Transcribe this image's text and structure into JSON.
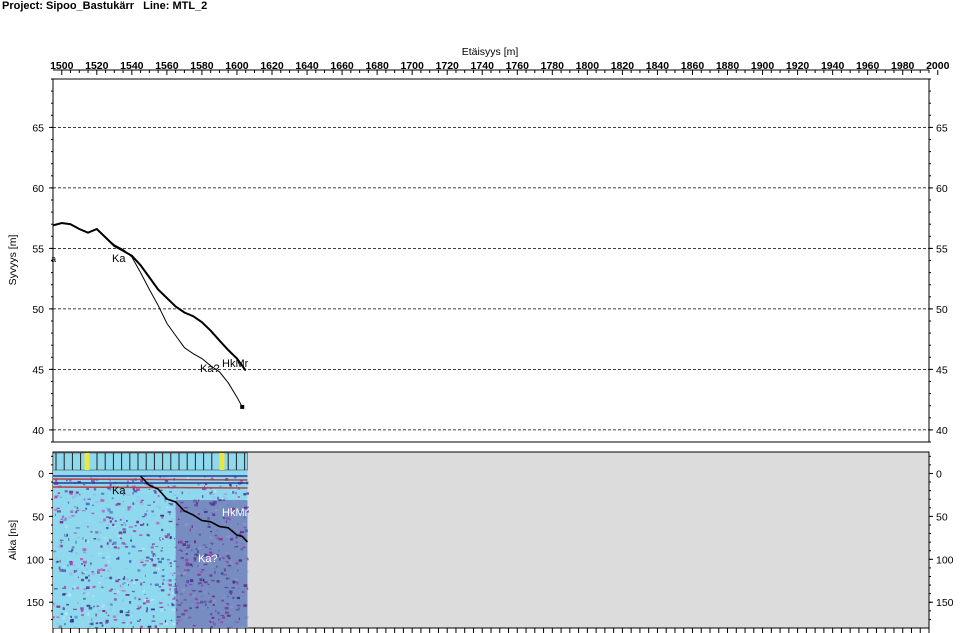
{
  "header": {
    "project_label": "Project: Sipoo_Bastukärr",
    "line_label": "Line: MTL_2"
  },
  "chart_data": [
    {
      "type": "line",
      "xlabel": "Etäisyys [m]",
      "ylabel": "Syvyys [m]",
      "xlim": [
        1495,
        1995
      ],
      "ylim": [
        39,
        69
      ],
      "x_ticks": [
        "1500",
        "1520",
        "1540",
        "1560",
        "1580",
        "1600",
        "1620",
        "1640",
        "1660",
        "1680",
        "1700",
        "1720",
        "1740",
        "1760",
        "1780",
        "1800",
        "1820",
        "1840",
        "1860",
        "1880",
        "1900",
        "1920",
        "1940",
        "1960",
        "1980",
        "2000"
      ],
      "y_ticks": [
        40,
        45,
        50,
        55,
        60,
        65
      ],
      "y_tick_labels": [
        "40",
        "45",
        "50",
        "55",
        "60",
        "65"
      ],
      "grid": "horizontal dashed",
      "series": [
        {
          "name": "HkMr",
          "x": [
            1495,
            1500,
            1505,
            1510,
            1515,
            1520,
            1525,
            1530,
            1535,
            1540,
            1545,
            1550,
            1555,
            1560,
            1565,
            1570,
            1575,
            1580,
            1585,
            1590,
            1595,
            1600,
            1605
          ],
          "y": [
            56.9,
            57.1,
            57.0,
            56.6,
            56.3,
            56.6,
            55.9,
            55.2,
            54.8,
            54.4,
            53.6,
            52.6,
            51.6,
            50.9,
            50.2,
            49.7,
            49.4,
            48.9,
            48.2,
            47.4,
            46.6,
            45.9,
            44.9
          ]
        },
        {
          "name": "Ka?",
          "x": [
            1495,
            1500,
            1505,
            1510,
            1515,
            1520,
            1525,
            1530,
            1535,
            1540,
            1545,
            1550,
            1555,
            1560,
            1565,
            1570,
            1575,
            1580,
            1585,
            1590,
            1595,
            1600,
            1603
          ],
          "y": [
            56.9,
            57.1,
            57.0,
            56.6,
            56.3,
            56.6,
            55.9,
            55.3,
            54.9,
            54.3,
            53.0,
            51.6,
            50.3,
            48.8,
            47.8,
            46.8,
            46.3,
            45.9,
            45.3,
            44.8,
            43.9,
            42.7,
            41.9
          ]
        }
      ],
      "annotations": [
        "Ka",
        "a",
        "Ka?",
        "HkMr"
      ]
    },
    {
      "type": "heatmap",
      "ylabel": "Aika [ns]",
      "y_ticks": [
        0,
        50,
        100,
        150
      ],
      "y_tick_labels": [
        "0",
        "50",
        "100",
        "150"
      ],
      "ylim": [
        -25,
        180
      ],
      "data_extent_x": [
        1495,
        1606
      ],
      "annotations": [
        "Ka",
        "HkMr",
        "Ka?"
      ],
      "colors": {
        "radargram_base": "#8fd9ee",
        "radargram_dark": "#5a2f8a",
        "empty_area": "#dcdcdc",
        "marker_bar": "#e8e840"
      }
    }
  ]
}
